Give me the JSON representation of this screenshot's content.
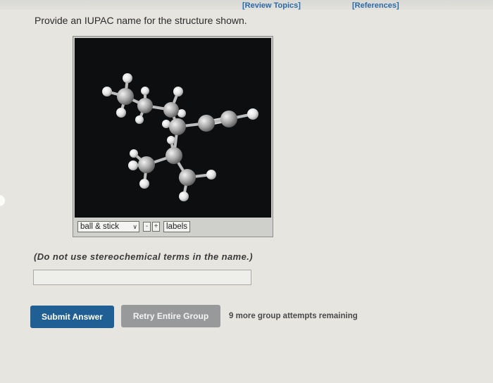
{
  "header": {
    "review_topics": "[Review Topics]",
    "references": "[References]"
  },
  "question": {
    "prompt": "Provide an IUPAC name for the structure shown.",
    "hint": "(Do not use stereochemical terms in the name.)"
  },
  "viewer": {
    "style_value": "ball & stick",
    "minus": "-",
    "plus": "+",
    "labels": "labels"
  },
  "answer_field": {
    "value": ""
  },
  "actions": {
    "submit": "Submit Answer",
    "retry": "Retry Entire Group",
    "attempts": "9 more group attempts remaining"
  },
  "colors": {
    "primary_button": "#1f5f94",
    "secondary_button": "#97999a",
    "link": "#2a6aa8",
    "viewer_bg": "#0d0e0f"
  },
  "icons": {
    "dropdown": "chevron-down-icon"
  }
}
